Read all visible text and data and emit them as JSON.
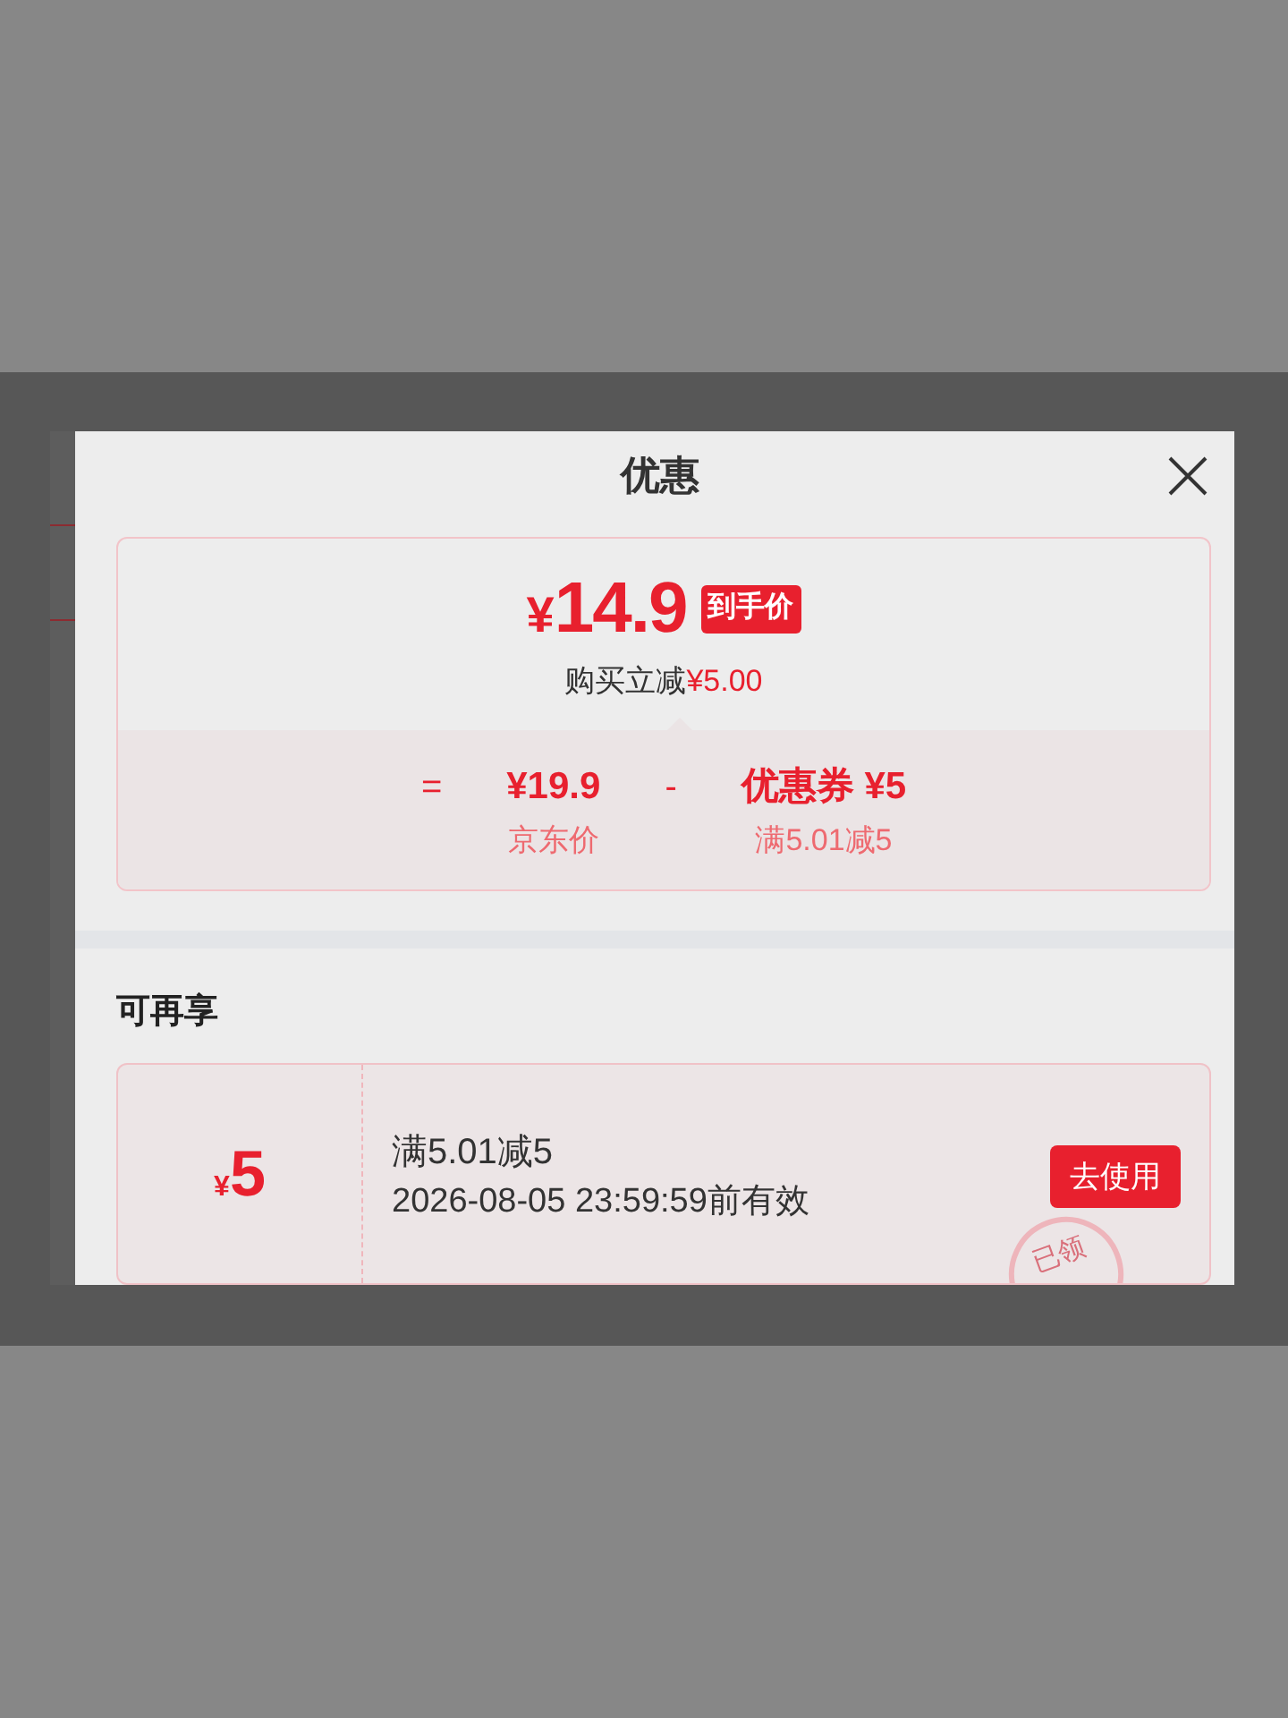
{
  "dialog": {
    "title": "优惠"
  },
  "price_card": {
    "currency": "¥",
    "final_price": "14.9",
    "price_tag": "到手价",
    "saving_label": "购买立减",
    "saving_amount": "¥5.00",
    "breakdown": [
      {
        "operator": "=",
        "value": "¥19.9",
        "label": "京东价"
      },
      {
        "operator": "-",
        "value": "优惠券 ¥5",
        "label": "满5.01减5"
      }
    ]
  },
  "more_offers": {
    "title": "可再享",
    "coupons": [
      {
        "currency": "¥",
        "amount": "5",
        "condition": "满5.01减5",
        "validity": "2026-08-05 23:59:59前有效",
        "action": "去使用",
        "claimed": true,
        "stamp": "已领"
      }
    ]
  }
}
